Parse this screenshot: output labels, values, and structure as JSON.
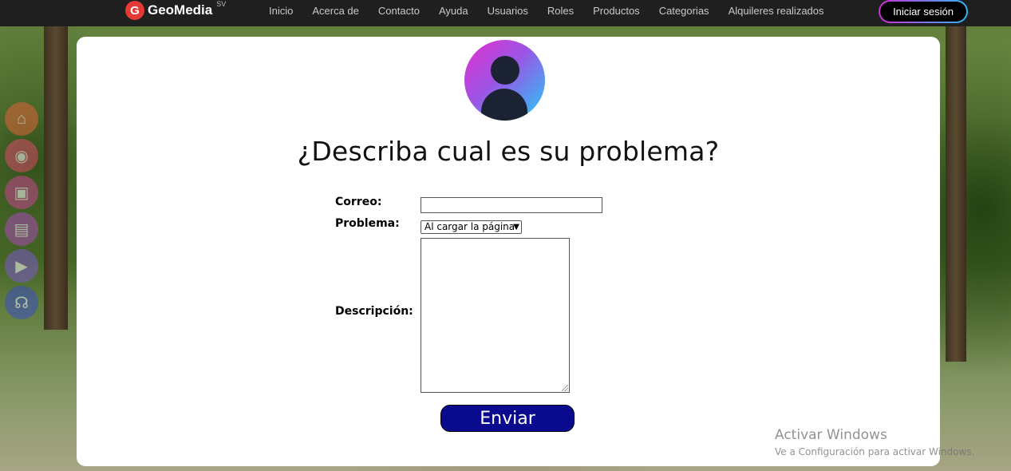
{
  "brand": {
    "logo_letter": "G",
    "name": "GeoMedia",
    "superscript": "SV"
  },
  "nav": {
    "links": [
      "Inicio",
      "Acerca de",
      "Contacto",
      "Ayuda",
      "Usuarios",
      "Roles",
      "Productos",
      "Categorias",
      "Alquileres realizados"
    ],
    "login_label": "Iniciar sesión"
  },
  "side_icons": [
    {
      "name": "home-icon",
      "color": "#e0643a"
    },
    {
      "name": "camera-icon",
      "color": "#d94c6a"
    },
    {
      "name": "gallery-icon",
      "color": "#c6458f"
    },
    {
      "name": "document-icon",
      "color": "#a84bb5"
    },
    {
      "name": "video-icon",
      "color": "#7d58c9"
    },
    {
      "name": "headphones-icon",
      "color": "#3b4fc2"
    }
  ],
  "form": {
    "heading": "¿Describa cual es su problema?",
    "email_label": "Correo:",
    "email_value": "",
    "problem_label": "Problema:",
    "problem_selected": "Al cargar la página",
    "description_label": "Descripción:",
    "description_value": "",
    "submit_label": "Enviar"
  },
  "watermark": {
    "title": "Activar Windows",
    "subtitle": "Ve a Configuración para activar Windows."
  }
}
